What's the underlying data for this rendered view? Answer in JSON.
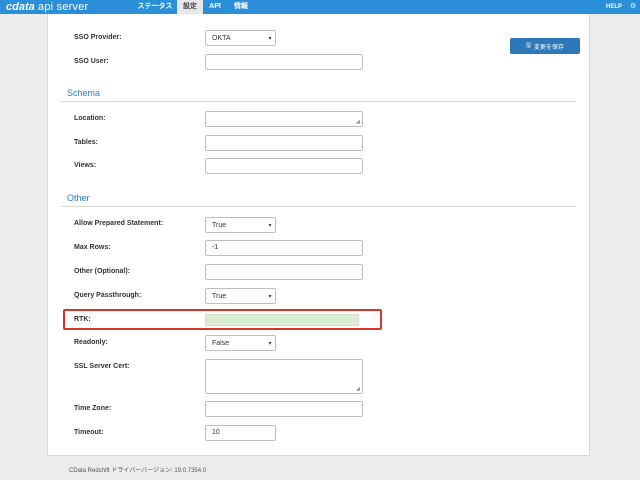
{
  "header": {
    "brand_main": "cdata",
    "brand_sub": "api server",
    "nav": [
      "ステータス",
      "設定",
      "API",
      "情報"
    ],
    "active_nav": "設定",
    "help": "HELP",
    "corner_icon": "gear-icon"
  },
  "actions": {
    "save_label": "変更を保存",
    "save_icon": "save-icon"
  },
  "sso": {
    "provider_label": "SSO Provider:",
    "provider_value": "OKTA",
    "user_label": "SSO User:",
    "user_value": ""
  },
  "schema": {
    "title": "Schema",
    "location_label": "Location:",
    "tables_label": "Tables:",
    "views_label": "Views:"
  },
  "other": {
    "title": "Other",
    "allow_prepared_label": "Allow Prepared Statement:",
    "allow_prepared_value": "True",
    "max_rows_label": "Max Rows:",
    "max_rows_value": "-1",
    "other_optional_label": "Other (Optional):",
    "query_passthrough_label": "Query Passthrough:",
    "query_passthrough_value": "True",
    "rtk_label": "RTK:",
    "readonly_label": "Readonly:",
    "readonly_value": "False",
    "ssl_cert_label": "SSL Server Cert:",
    "time_zone_label": "Time Zone:",
    "timeout_label": "Timeout:",
    "timeout_value": "10"
  },
  "footer": {
    "version_text": "CData Redshift ドライバーバージョン: 19.0.7354.0"
  },
  "colors": {
    "accent": "#2a8fd8",
    "save_button": "#2d78b8",
    "highlight": "#d9352b",
    "rtk_fill": "#dcebd4"
  }
}
